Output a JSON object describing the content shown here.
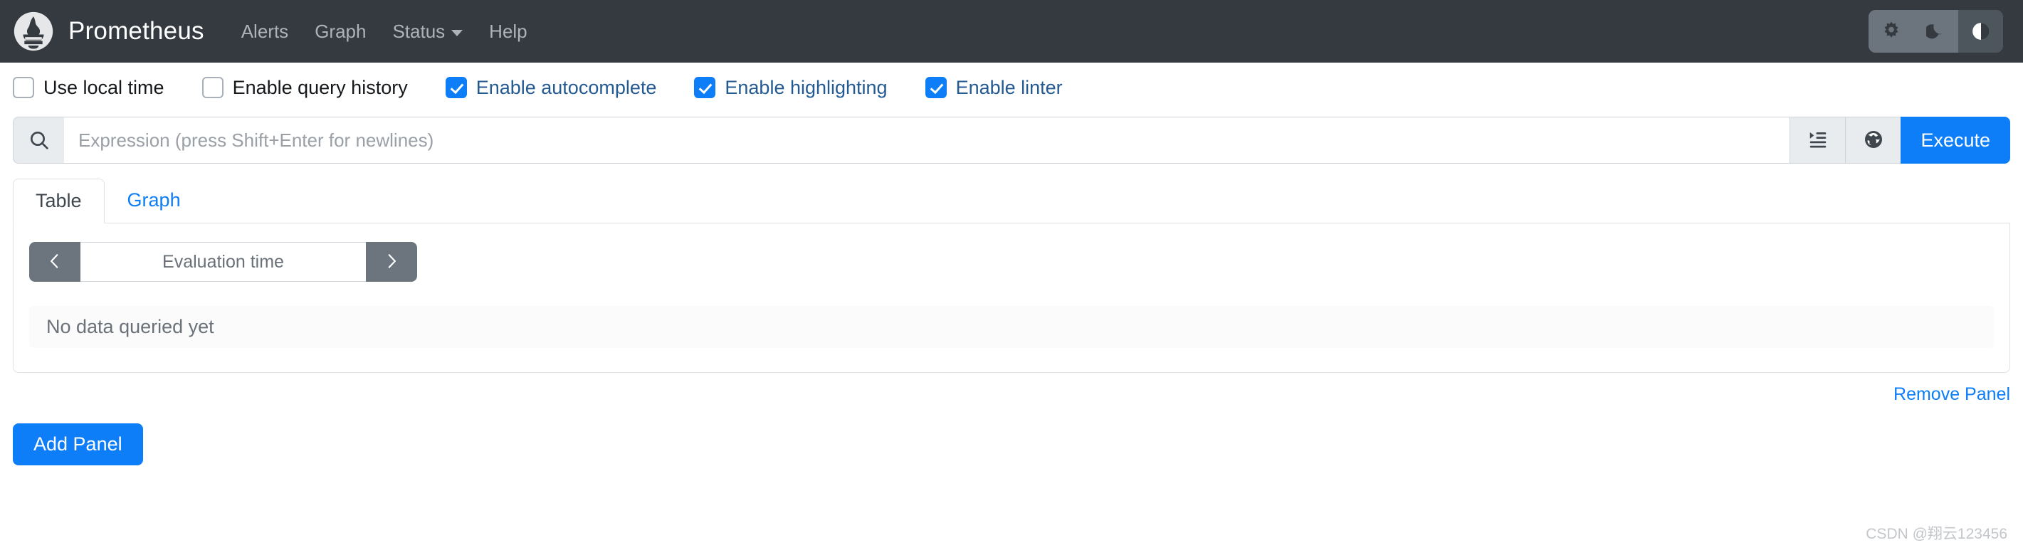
{
  "navbar": {
    "brand_title": "Prometheus",
    "logo_icon": "prometheus-logo-icon",
    "links": [
      {
        "label": "Alerts",
        "has_caret": false
      },
      {
        "label": "Graph",
        "has_caret": false
      },
      {
        "label": "Status",
        "has_caret": true
      },
      {
        "label": "Help",
        "has_caret": false
      }
    ],
    "theme_buttons": [
      {
        "name": "light-theme",
        "icon": "sun-icon",
        "active": false
      },
      {
        "name": "dark-theme",
        "icon": "moon-icon",
        "active": false
      },
      {
        "name": "auto-theme",
        "icon": "half-circle-icon",
        "active": true
      }
    ],
    "background_color": "#343a40",
    "link_color": "#adb3b9"
  },
  "options": {
    "checkboxes": [
      {
        "label": "Use local time",
        "checked": false
      },
      {
        "label": "Enable query history",
        "checked": false
      },
      {
        "label": "Enable autocomplete",
        "checked": true
      },
      {
        "label": "Enable highlighting",
        "checked": true
      },
      {
        "label": "Enable linter",
        "checked": true
      }
    ],
    "checked_label_color": "#245a92",
    "unchecked_label_color": "#15181b",
    "checkbox_accent": "#0d7ef7"
  },
  "query": {
    "search_icon": "search-icon",
    "expression_value": "",
    "expression_placeholder": "Expression (press Shift+Enter for newlines)",
    "format_button_icon": "format-indent-icon",
    "metrics_explorer_icon": "globe-icon",
    "execute_label": "Execute",
    "execute_color": "#0d7ef7"
  },
  "panel": {
    "tabs": [
      {
        "label": "Table",
        "active": true
      },
      {
        "label": "Graph",
        "active": false
      }
    ],
    "evaluation_time": {
      "prev_icon": "chevron-left-icon",
      "next_icon": "chevron-right-icon",
      "value": "",
      "placeholder": "Evaluation time"
    },
    "empty_message": "No data queried yet",
    "remove_panel_label": "Remove Panel"
  },
  "footer": {
    "add_panel_label": "Add Panel"
  },
  "watermark": {
    "text": "CSDN @翔云123456"
  }
}
